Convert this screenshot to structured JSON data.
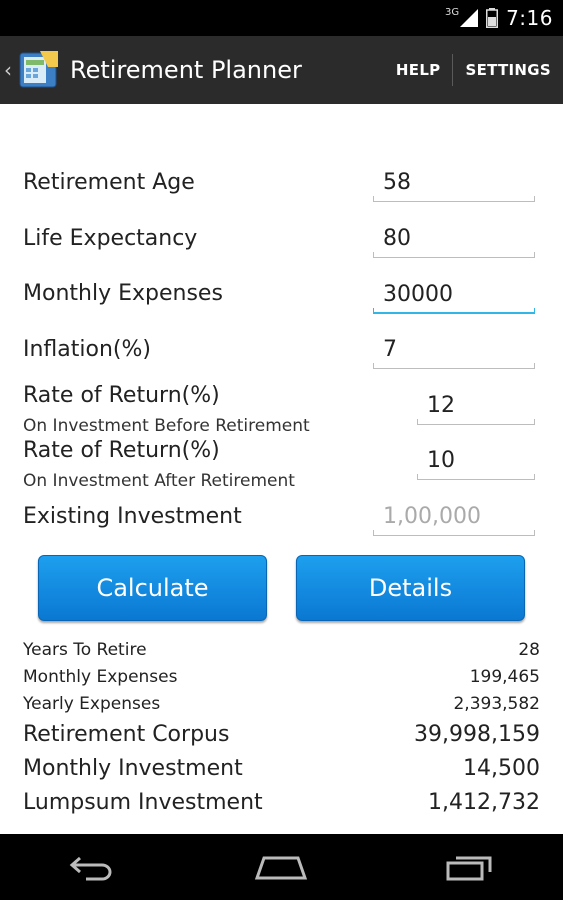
{
  "status_bar": {
    "network": "3G",
    "time": "7:16"
  },
  "action_bar": {
    "title": "Retirement Planner",
    "help": "HELP",
    "settings": "SETTINGS"
  },
  "form": {
    "retirement_age": {
      "label": "Retirement Age",
      "value": "58"
    },
    "life_expectancy": {
      "label": "Life Expectancy",
      "value": "80"
    },
    "monthly_expenses": {
      "label": "Monthly Expenses",
      "value": "30000"
    },
    "inflation": {
      "label": "Inflation(%)",
      "value": "7"
    },
    "return_before": {
      "label": "Rate of Return(%)",
      "sublabel": "On Investment Before Retirement",
      "value": "12"
    },
    "return_after": {
      "label": "Rate of Return(%)",
      "sublabel": "On Investment After Retirement",
      "value": "10"
    },
    "existing_investment": {
      "label": "Existing Investment",
      "placeholder": "1,00,000",
      "value": ""
    }
  },
  "buttons": {
    "calculate": "Calculate",
    "details": "Details"
  },
  "results": [
    {
      "label": "Years To Retire",
      "value": "28"
    },
    {
      "label": "Monthly Expenses",
      "value": "199,465"
    },
    {
      "label": "Yearly Expenses",
      "value": "2,393,582"
    },
    {
      "label": "Retirement Corpus",
      "value": "39,998,159"
    },
    {
      "label": "Monthly Investment",
      "value": "14,500"
    },
    {
      "label": "Lumpsum Investment",
      "value": "1,412,732"
    }
  ],
  "colors": {
    "accent": "#33b5e5",
    "button": "#1a8fe3",
    "action_bar": "#2b2b2b"
  }
}
